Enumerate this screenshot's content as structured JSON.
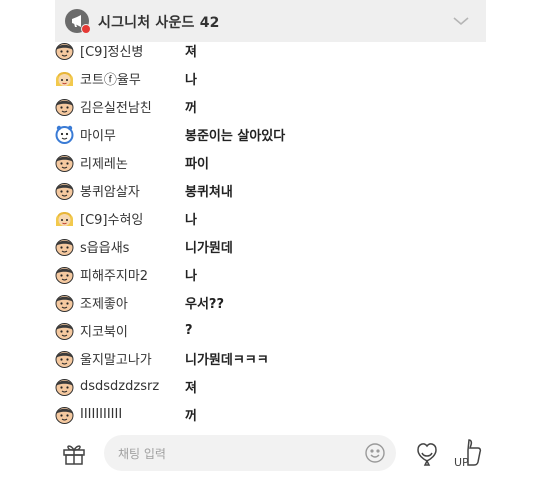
{
  "header": {
    "title": "시그니처 사운드 42"
  },
  "messages": [
    {
      "nick": "[C9]정신병",
      "text": "져",
      "avatar": "face-icon"
    },
    {
      "nick": "코트ⓕ율무",
      "text": "나",
      "avatar": "blonde-face-icon"
    },
    {
      "nick": "김은실전남친",
      "text": "꺼",
      "avatar": "face-icon"
    },
    {
      "nick": "마이무",
      "text": "봉준이는 살아있다",
      "avatar": "alarm-clock-icon"
    },
    {
      "nick": "리제레논",
      "text": "파이",
      "avatar": "face-icon"
    },
    {
      "nick": "봉퀴암살자",
      "text": "봉퀴쳐내",
      "avatar": "face-icon"
    },
    {
      "nick": "[C9]수혀잉",
      "text": "나",
      "avatar": "blonde-face-icon"
    },
    {
      "nick": "s읍읍새s",
      "text": "니가뭔데",
      "avatar": "face-icon"
    },
    {
      "nick": "피해주지마2",
      "text": "나",
      "avatar": "face-icon"
    },
    {
      "nick": "조제좋아",
      "text": "우서??",
      "avatar": "face-icon"
    },
    {
      "nick": "지코북이",
      "text": "?",
      "avatar": "face-icon"
    },
    {
      "nick": "울지말고나가",
      "text": "니가뭔데ㅋㅋㅋ",
      "avatar": "face-icon"
    },
    {
      "nick": "dsdsdzdzsrz",
      "text": "져",
      "avatar": "face-icon"
    },
    {
      "nick": "IIIIIIIIIII",
      "text": "꺼",
      "avatar": "face-icon"
    }
  ],
  "input": {
    "placeholder": "채팅 입력"
  },
  "icons": {
    "header": "megaphone-icon",
    "collapse": "chevron-down-icon",
    "gift": "gift-icon",
    "emoji": "smile-icon",
    "balloon": "balloon-icon",
    "up": "thumbs-up-icon"
  },
  "colors": {
    "notification_dot": "#e53935",
    "header_bg": "#efefef",
    "input_bg": "#f2f2f2"
  }
}
